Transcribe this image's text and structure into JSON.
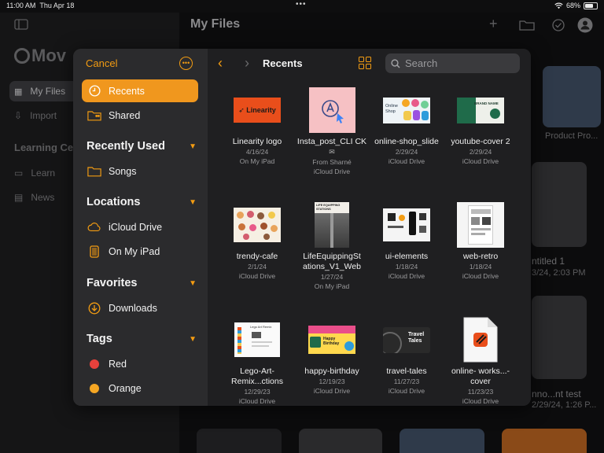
{
  "status": {
    "time": "11:00 AM",
    "date": "Thu Apr 18",
    "battery": "68%",
    "battery_level": 0.68
  },
  "background": {
    "title": "My Files",
    "logo": "Mov",
    "sidebar": [
      {
        "label": "My Files"
      },
      {
        "label": "Import"
      },
      {
        "label": "Learning Ce"
      },
      {
        "label": "Learn"
      },
      {
        "label": "News"
      }
    ],
    "cards": [
      {
        "label": "Product Pro..."
      },
      {
        "label": "ntitled 1"
      },
      {
        "label": "3/24, 2:03 PM"
      },
      {
        "label": "nno...nt test"
      },
      {
        "label": "2/29/24, 1:26 P..."
      }
    ]
  },
  "picker": {
    "cancel_label": "Cancel",
    "locations_title": "Recents",
    "search_placeholder": "Search",
    "sidebar": {
      "top": [
        {
          "label": "Recents",
          "icon": "clock-icon",
          "selected": true
        },
        {
          "label": "Shared",
          "icon": "shared-folder-icon",
          "selected": false
        }
      ],
      "sections": [
        {
          "title": "Recently Used",
          "items": [
            {
              "label": "Songs",
              "icon": "folder-icon"
            }
          ]
        },
        {
          "title": "Locations",
          "items": [
            {
              "label": "iCloud Drive",
              "icon": "cloud-icon"
            },
            {
              "label": "On My iPad",
              "icon": "ipad-icon"
            }
          ]
        },
        {
          "title": "Favorites",
          "items": [
            {
              "label": "Downloads",
              "icon": "download-icon"
            }
          ]
        },
        {
          "title": "Tags",
          "items": [
            {
              "label": "Red",
              "color": "#e8413c"
            },
            {
              "label": "Orange",
              "color": "#f5a623"
            }
          ]
        }
      ]
    },
    "files": [
      {
        "name": "Linearity logo",
        "date": "4/16/24",
        "location": "On My iPad"
      },
      {
        "name": "Insta_post_CLI CK",
        "date": "From Sharné",
        "location": "iCloud Drive"
      },
      {
        "name": "online-shop_slide",
        "date": "2/29/24",
        "location": "iCloud Drive"
      },
      {
        "name": "youtube-cover 2",
        "date": "2/29/24",
        "location": "iCloud Drive"
      },
      {
        "name": "trendy-cafe",
        "date": "2/1/24",
        "location": "iCloud Drive"
      },
      {
        "name": "LifeEquippingSt ations_V1_Web",
        "date": "1/27/24",
        "location": "On My iPad"
      },
      {
        "name": "ui-elements",
        "date": "1/18/24",
        "location": "iCloud Drive"
      },
      {
        "name": "web-retro",
        "date": "1/18/24",
        "location": "iCloud Drive"
      },
      {
        "name": "Lego-Art- Remix...ctions",
        "date": "12/29/23",
        "location": "iCloud Drive"
      },
      {
        "name": "happy-birthday",
        "date": "12/19/23",
        "location": "iCloud Drive"
      },
      {
        "name": "travel-tales",
        "date": "11/27/23",
        "location": "iCloud Drive"
      },
      {
        "name": "online- works...-cover",
        "date": "11/23/23",
        "location": "iCloud Drive"
      }
    ],
    "thumb_text": {
      "linearity": "Linearity",
      "online_shop": "Online Shop",
      "brand": "BRAND NAME",
      "happy": "Happy Birthday",
      "travel": "Travel Tales",
      "lego": "Lego Art Remix",
      "life": "LIFE EQUIPPING STATIONS"
    }
  },
  "colors": {
    "accent": "#f39c12",
    "selected_bg": "#f0971e"
  }
}
